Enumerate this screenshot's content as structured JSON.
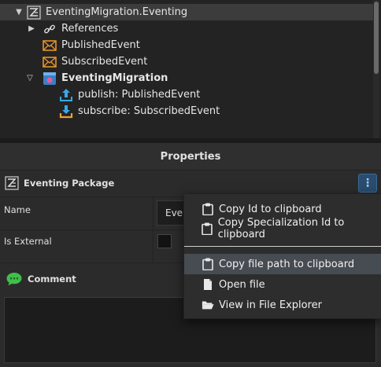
{
  "tree": {
    "items": [
      {
        "label": "EventingMigration.Eventing",
        "icon": "eventing-package-icon",
        "selected": true
      },
      {
        "label": "References",
        "icon": "link-icon"
      },
      {
        "label": "PublishedEvent",
        "icon": "message-envelope-icon"
      },
      {
        "label": "SubscribedEvent",
        "icon": "message-envelope-icon"
      },
      {
        "label": "EventingMigration",
        "icon": "application-icon"
      },
      {
        "label": "publish: PublishedEvent",
        "icon": "publish-arrow-icon"
      },
      {
        "label": "subscribe: SubscribedEvent",
        "icon": "subscribe-arrow-icon"
      }
    ]
  },
  "properties": {
    "title": "Properties",
    "package_label": "Eventing Package",
    "more_button": "⋮",
    "name_label": "Name",
    "name_value": "Even",
    "is_external_label": "Is External",
    "comment_label": "Comment"
  },
  "menu": {
    "items": [
      {
        "label": "Copy Id to clipboard",
        "icon": "clipboard-icon"
      },
      {
        "label": "Copy Specialization Id to clipboard",
        "icon": "clipboard-icon"
      },
      {
        "label": "Copy file path to clipboard",
        "icon": "clipboard-icon",
        "hovered": true
      },
      {
        "label": "Open file",
        "icon": "file-icon"
      },
      {
        "label": "View in File Explorer",
        "icon": "folder-open-icon"
      }
    ]
  },
  "colors": {
    "background": "#2b2b2b",
    "tree_background": "#232323",
    "accent_blue": "#2a4c6e",
    "envelope_orange": "#e8922a",
    "menu_hover": "#474b52"
  }
}
